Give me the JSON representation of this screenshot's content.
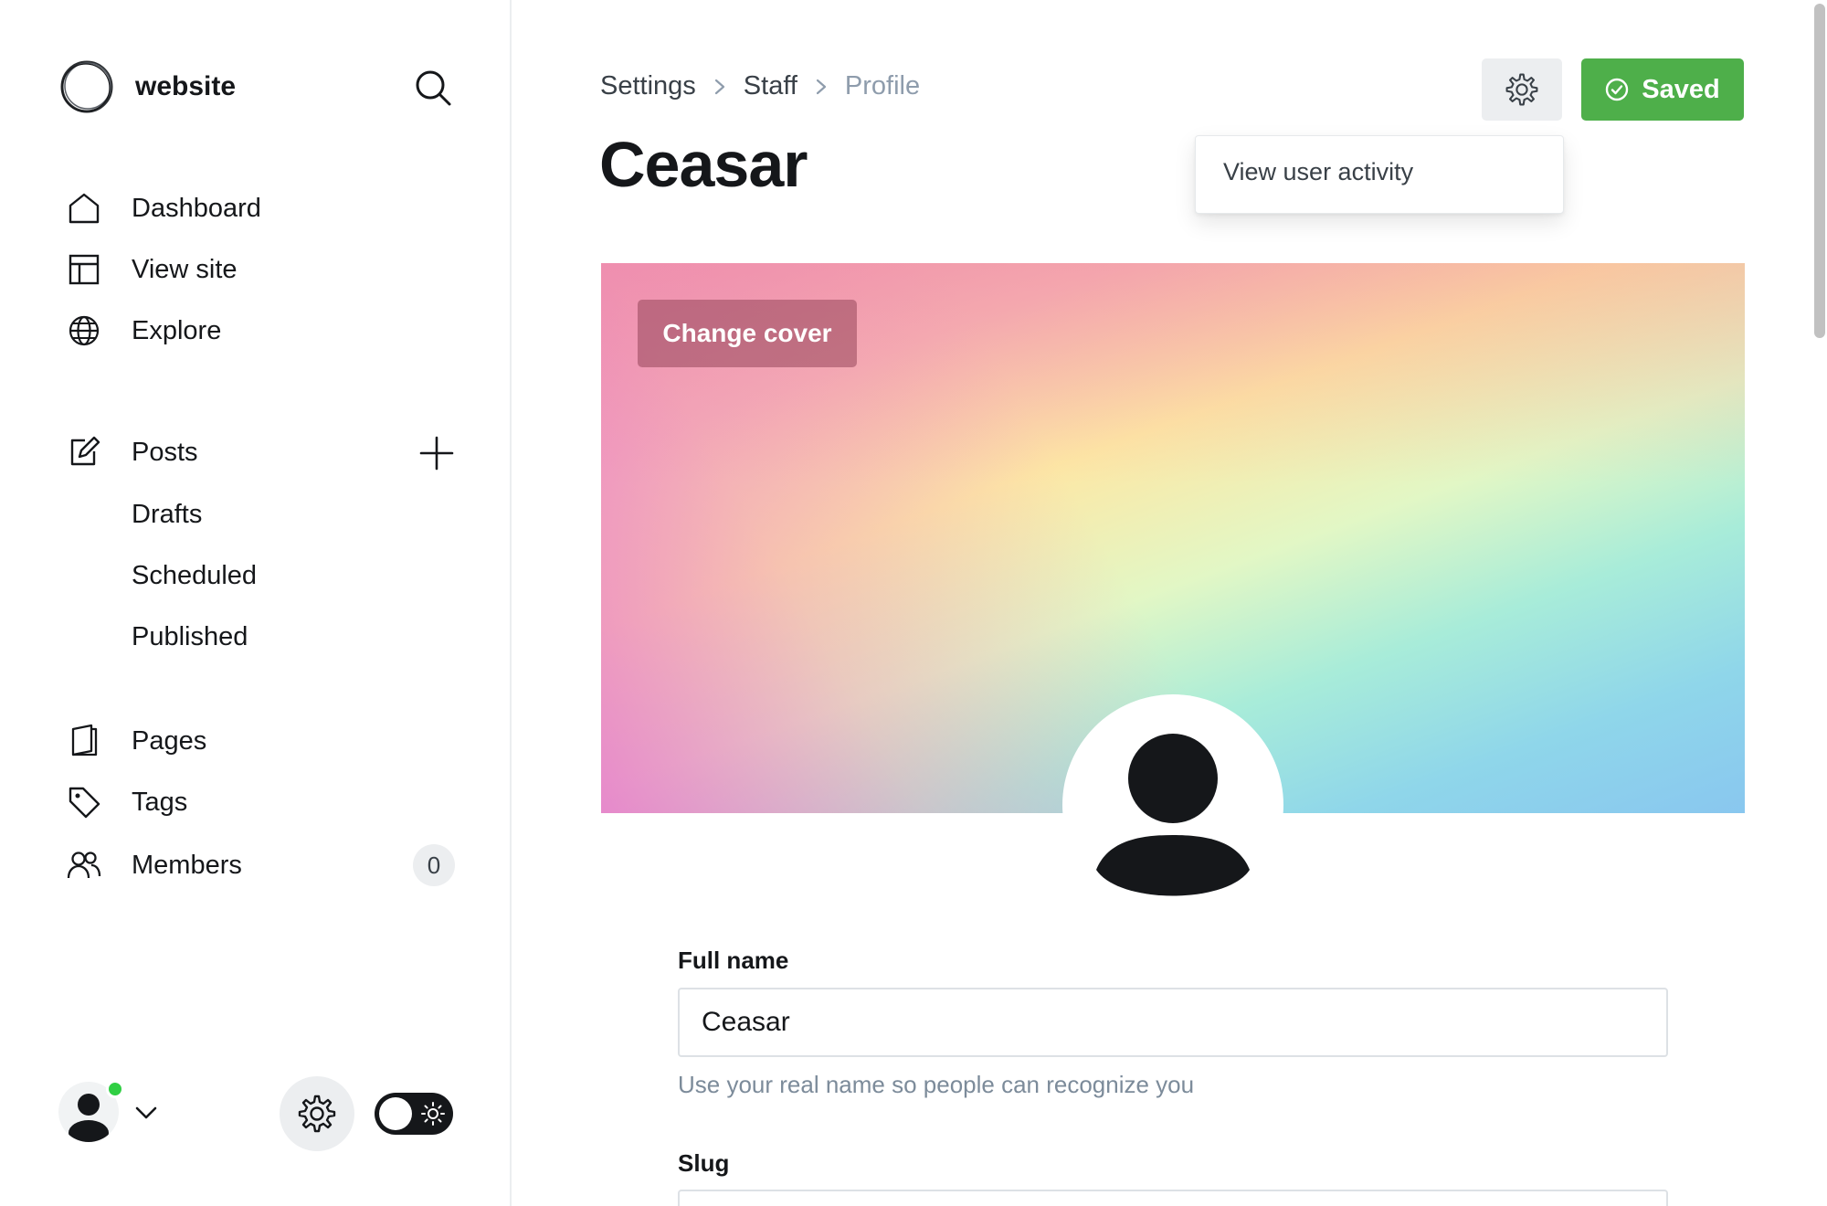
{
  "sidebar": {
    "site_name": "website",
    "nav": {
      "dashboard": "Dashboard",
      "view_site": "View site",
      "explore": "Explore",
      "posts": "Posts",
      "drafts": "Drafts",
      "scheduled": "Scheduled",
      "published": "Published",
      "pages": "Pages",
      "tags": "Tags",
      "members": "Members",
      "members_count": "0"
    },
    "user_status_color": "#30cf43"
  },
  "header": {
    "breadcrumb": [
      "Settings",
      "Staff",
      "Profile"
    ],
    "title": "Ceasar",
    "saved_label": "Saved",
    "saved_color": "#4eaf4a"
  },
  "dropdown": {
    "items": [
      "View user activity"
    ]
  },
  "cover": {
    "change_cover_label": "Change cover"
  },
  "form": {
    "full_name": {
      "label": "Full name",
      "value": "Ceasar",
      "hint": "Use your real name so people can recognize you"
    },
    "slug": {
      "label": "Slug"
    }
  }
}
